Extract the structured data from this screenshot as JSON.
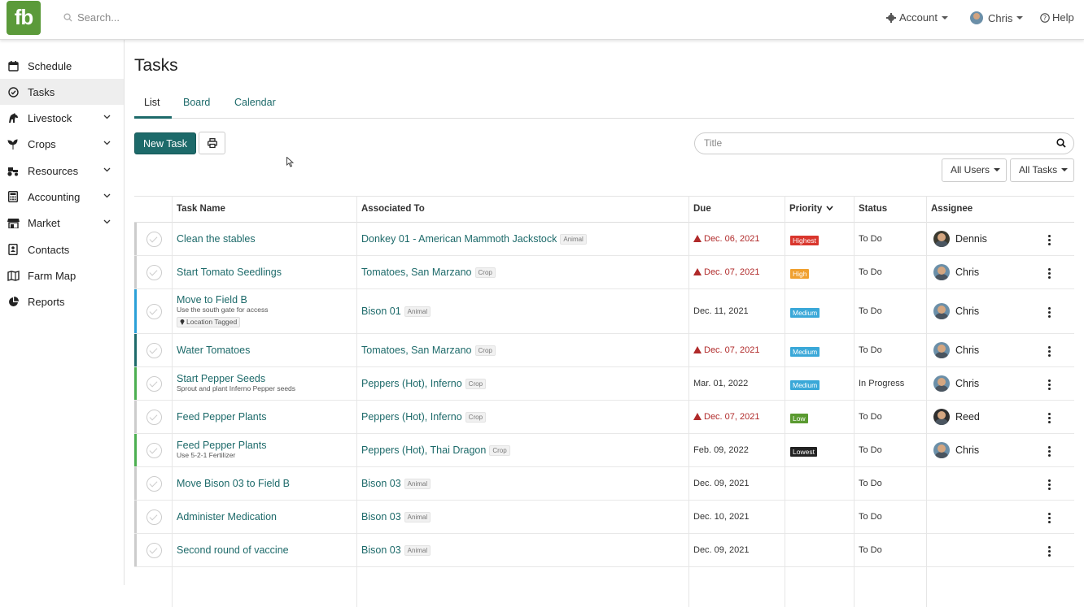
{
  "app": {
    "logo_text": "fb",
    "brand_color": "#5b9a3a",
    "accent_color": "#1d6a6a"
  },
  "topbar": {
    "search_placeholder": "Search...",
    "account_label": "Account",
    "user_label": "Chris",
    "help_label": "Help"
  },
  "sidebar": {
    "items": [
      {
        "label": "Schedule",
        "icon": "calendar-icon",
        "active": false,
        "expandable": false
      },
      {
        "label": "Tasks",
        "icon": "check-circle-icon",
        "active": true,
        "expandable": false
      },
      {
        "label": "Livestock",
        "icon": "horse-icon",
        "active": false,
        "expandable": true
      },
      {
        "label": "Crops",
        "icon": "seedling-icon",
        "active": false,
        "expandable": true
      },
      {
        "label": "Resources",
        "icon": "tractor-icon",
        "active": false,
        "expandable": true
      },
      {
        "label": "Accounting",
        "icon": "calculator-icon",
        "active": false,
        "expandable": true
      },
      {
        "label": "Market",
        "icon": "store-icon",
        "active": false,
        "expandable": true
      },
      {
        "label": "Contacts",
        "icon": "address-book-icon",
        "active": false,
        "expandable": false
      },
      {
        "label": "Farm Map",
        "icon": "map-icon",
        "active": false,
        "expandable": false
      },
      {
        "label": "Reports",
        "icon": "pie-chart-icon",
        "active": false,
        "expandable": false
      }
    ]
  },
  "page": {
    "title": "Tasks",
    "tabs": [
      {
        "label": "List",
        "active": true
      },
      {
        "label": "Board",
        "active": false
      },
      {
        "label": "Calendar",
        "active": false
      }
    ],
    "new_task_label": "New Task",
    "title_search_placeholder": "Title",
    "filter_users": "All Users",
    "filter_tasks": "All Tasks"
  },
  "table": {
    "columns": {
      "task_name": "Task Name",
      "associated_to": "Associated To",
      "due": "Due",
      "priority": "Priority",
      "status": "Status",
      "assignee": "Assignee"
    },
    "rows": [
      {
        "name": "Clean the stables",
        "note": "",
        "location_tag": "",
        "assoc": "Donkey 01 - American Mammoth Jackstock",
        "assoc_type": "Animal",
        "due": "Dec. 06, 2021",
        "overdue": true,
        "priority": "Highest",
        "priority_color": "#d9362d",
        "status": "To Do",
        "assignee": "Dennis",
        "stripe": "#ccc"
      },
      {
        "name": "Start Tomato Seedlings",
        "note": "",
        "location_tag": "",
        "assoc": "Tomatoes, San Marzano",
        "assoc_type": "Crop",
        "due": "Dec. 07, 2021",
        "overdue": true,
        "priority": "High",
        "priority_color": "#f0a030",
        "status": "To Do",
        "assignee": "Chris",
        "stripe": "#ccc"
      },
      {
        "name": "Move to Field B",
        "note": "Use the south gate for access",
        "location_tag": "Location Tagged",
        "assoc": "Bison 01",
        "assoc_type": "Animal",
        "due": "Dec. 11, 2021",
        "overdue": false,
        "priority": "Medium",
        "priority_color": "#3aa8d8",
        "status": "To Do",
        "assignee": "Chris",
        "stripe": "#2aa0d8"
      },
      {
        "name": "Water Tomatoes",
        "note": "",
        "location_tag": "",
        "assoc": "Tomatoes, San Marzano",
        "assoc_type": "Crop",
        "due": "Dec. 07, 2021",
        "overdue": true,
        "priority": "Medium",
        "priority_color": "#3aa8d8",
        "status": "To Do",
        "assignee": "Chris",
        "stripe": "#1d6a6a"
      },
      {
        "name": "Start Pepper Seeds",
        "note": "Sprout and plant Inferno Pepper seeds",
        "location_tag": "",
        "assoc": "Peppers (Hot), Inferno",
        "assoc_type": "Crop",
        "due": "Mar. 01, 2022",
        "overdue": false,
        "priority": "Medium",
        "priority_color": "#3aa8d8",
        "status": "In Progress",
        "assignee": "Chris",
        "stripe": "#4caf50"
      },
      {
        "name": "Feed Pepper Plants",
        "note": "",
        "location_tag": "",
        "assoc": "Peppers (Hot), Inferno",
        "assoc_type": "Crop",
        "due": "Dec. 07, 2021",
        "overdue": true,
        "priority": "Low",
        "priority_color": "#5a9a30",
        "status": "To Do",
        "assignee": "Reed",
        "stripe": "#ccc"
      },
      {
        "name": "Feed Pepper Plants",
        "note": "Use 5-2-1 Fertilizer",
        "location_tag": "",
        "assoc": "Peppers (Hot), Thai Dragon",
        "assoc_type": "Crop",
        "due": "Feb. 09, 2022",
        "overdue": false,
        "priority": "Lowest",
        "priority_color": "#222222",
        "status": "To Do",
        "assignee": "Chris",
        "stripe": "#4caf50"
      },
      {
        "name": "Move Bison 03 to Field B",
        "note": "",
        "location_tag": "",
        "assoc": "Bison 03",
        "assoc_type": "Animal",
        "due": "Dec. 09, 2021",
        "overdue": false,
        "priority": "",
        "priority_color": "",
        "status": "To Do",
        "assignee": "",
        "stripe": "#ccc"
      },
      {
        "name": "Administer Medication",
        "note": "",
        "location_tag": "",
        "assoc": "Bison 03",
        "assoc_type": "Animal",
        "due": "Dec. 10, 2021",
        "overdue": false,
        "priority": "",
        "priority_color": "",
        "status": "To Do",
        "assignee": "",
        "stripe": "#ccc"
      },
      {
        "name": "Second round of vaccine",
        "note": "",
        "location_tag": "",
        "assoc": "Bison 03",
        "assoc_type": "Animal",
        "due": "Dec. 09, 2021",
        "overdue": false,
        "priority": "",
        "priority_color": "",
        "status": "To Do",
        "assignee": "",
        "stripe": "#ccc"
      }
    ]
  }
}
